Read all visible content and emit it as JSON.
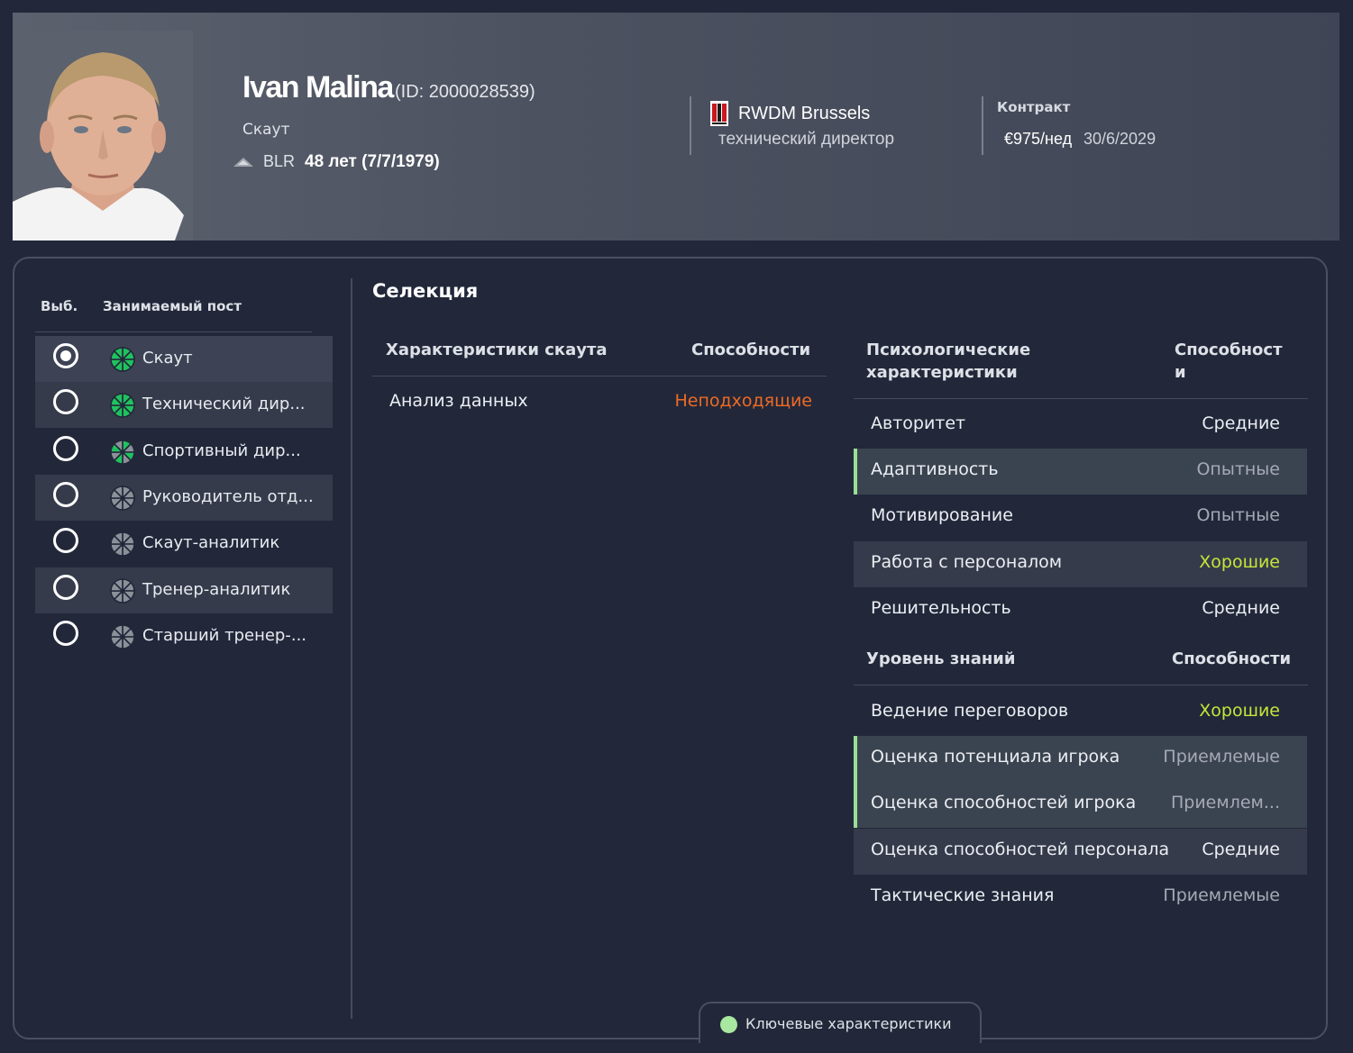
{
  "header": {
    "name": "Ivan Malina",
    "id_text": "(ID: 2000028539)",
    "role": "Скаут",
    "nationality": "BLR",
    "age_text": "48 лет (7/7/1979)",
    "club": "RWDM Brussels",
    "club_role": "технический директор",
    "contract_label": "Контракт",
    "wage": "€975/нед",
    "expiry": "30/6/2029"
  },
  "roles": {
    "col_select": "Выб.",
    "col_position": "Занимаемый пост",
    "items": [
      {
        "label": "Скаут",
        "selected": true,
        "rating": "high"
      },
      {
        "label": "Технический дир...",
        "selected": false,
        "rating": "high"
      },
      {
        "label": "Спортивный дир...",
        "selected": false,
        "rating": "medium"
      },
      {
        "label": "Руководитель отд...",
        "selected": false,
        "rating": "low"
      },
      {
        "label": "Скаут-аналитик",
        "selected": false,
        "rating": "low"
      },
      {
        "label": "Тренер-аналитик",
        "selected": false,
        "rating": "low"
      },
      {
        "label": "Старший тренер-...",
        "selected": false,
        "rating": "low"
      }
    ]
  },
  "selection": {
    "title": "Селекция",
    "scout": {
      "header_name": "Характеристики скаута",
      "header_value": "Способности",
      "rows": [
        {
          "name": "Анализ данных",
          "value": "Неподходящие",
          "color": "#ee6a24"
        }
      ]
    },
    "psych": {
      "header_name": "Психологические характеристики",
      "header_value": "Способност и",
      "rows": [
        {
          "name": "Авторитет",
          "value": "Средние",
          "color": "#eceef2",
          "key": false
        },
        {
          "name": "Адаптивность",
          "value": "Опытные",
          "color": "#a6aab4",
          "key": true
        },
        {
          "name": "Мотивирование",
          "value": "Опытные",
          "color": "#a6aab4",
          "key": false
        },
        {
          "name": "Работа с персоналом",
          "value": "Хорошие",
          "color": "#c6e43a",
          "key": false
        },
        {
          "name": "Решительность",
          "value": "Средние",
          "color": "#eceef2",
          "key": false
        }
      ]
    },
    "knowledge": {
      "header_name": "Уровень знаний",
      "header_value": "Способности",
      "rows": [
        {
          "name": "Ведение переговоров",
          "value": "Хорошие",
          "color": "#c6e43a",
          "key": false
        },
        {
          "name": "Оценка потенциала игрока",
          "value": "Приемлемые",
          "color": "#a6aab4",
          "key": true
        },
        {
          "name": "Оценка способностей игрока",
          "value": "Приемлем...",
          "color": "#a6aab4",
          "key": true
        },
        {
          "name": "Оценка способностей персонала",
          "value": "Средние",
          "color": "#eceef2",
          "key": false
        },
        {
          "name": "Тактические знания",
          "value": "Приемлемые",
          "color": "#a6aab4",
          "key": false
        }
      ]
    }
  },
  "legend": {
    "label": "Ключевые характеристики",
    "color": "#a8e8a0"
  }
}
